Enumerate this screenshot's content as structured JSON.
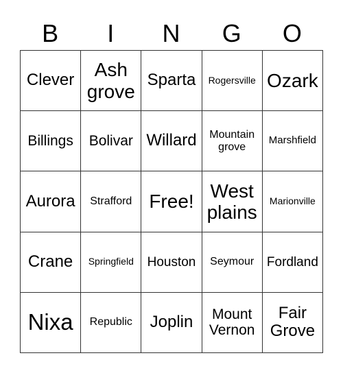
{
  "header": {
    "letters": [
      "B",
      "I",
      "N",
      "G",
      "O"
    ]
  },
  "rows": [
    [
      {
        "text": "Clever",
        "size": "s-m"
      },
      {
        "text": "Ash grove",
        "size": "s-l"
      },
      {
        "text": "Sparta",
        "size": "s-m"
      },
      {
        "text": "Rogersville",
        "size": "s-tiny"
      },
      {
        "text": "Ozark",
        "size": "s-l"
      }
    ],
    [
      {
        "text": "Billings",
        "size": "s-ms"
      },
      {
        "text": "Bolivar",
        "size": "s-ms"
      },
      {
        "text": "Willard",
        "size": "s-m"
      },
      {
        "text": "Mountain grove",
        "size": "s-xs"
      },
      {
        "text": "Marshfield",
        "size": "s-xxs"
      }
    ],
    [
      {
        "text": "Aurora",
        "size": "s-m"
      },
      {
        "text": "Strafford",
        "size": "s-xs"
      },
      {
        "text": "Free!",
        "size": "s-l"
      },
      {
        "text": "West plains",
        "size": "s-l"
      },
      {
        "text": "Marionville",
        "size": "s-tiny"
      }
    ],
    [
      {
        "text": "Crane",
        "size": "s-m"
      },
      {
        "text": "Springfield",
        "size": "s-tiny"
      },
      {
        "text": "Houston",
        "size": "s-s"
      },
      {
        "text": "Seymour",
        "size": "s-xs"
      },
      {
        "text": "Fordland",
        "size": "s-s"
      }
    ],
    [
      {
        "text": "Nixa",
        "size": "s-xl"
      },
      {
        "text": "Republic",
        "size": "s-xs"
      },
      {
        "text": "Joplin",
        "size": "s-m"
      },
      {
        "text": "Mount Vernon",
        "size": "s-ms"
      },
      {
        "text": "Fair Grove",
        "size": "s-m"
      }
    ]
  ]
}
